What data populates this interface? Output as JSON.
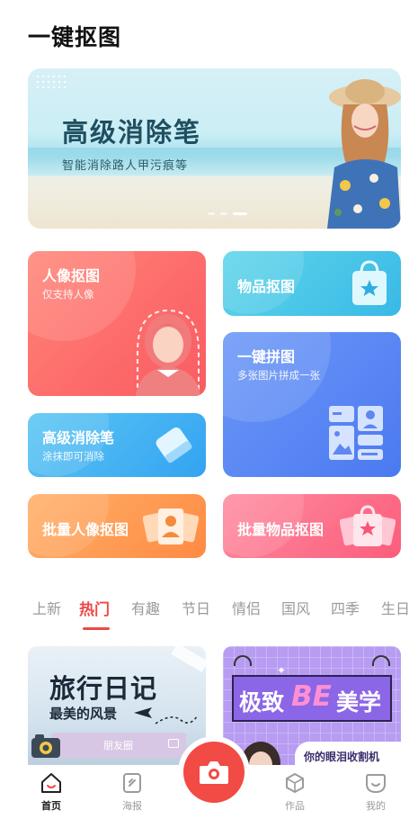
{
  "app": {
    "title": "一键抠图"
  },
  "banner": {
    "title": "高级消除笔",
    "subtitle": "智能消除路人甲污痕等",
    "page_count": 3,
    "active_page": 3
  },
  "features": {
    "portrait": {
      "title": "人像抠图",
      "subtitle": "仅支持人像",
      "icon": "portrait-silhouette-icon"
    },
    "object": {
      "title": "物品抠图",
      "icon": "shopping-bag-icon"
    },
    "collage": {
      "title": "一键拼图",
      "subtitle": "多张图片拼成一张",
      "icon": "collage-grid-icon"
    },
    "eraser": {
      "title": "高级消除笔",
      "subtitle": "涂抹即可消除",
      "icon": "eraser-icon"
    },
    "batch_portrait": {
      "title": "批量人像抠图",
      "icon": "portrait-stack-icon"
    },
    "batch_object": {
      "title": "批量物品抠图",
      "icon": "shopping-bag-stack-icon"
    }
  },
  "categories": {
    "active_index": 1,
    "items": [
      "上新",
      "热门",
      "有趣",
      "节日",
      "情侣",
      "国风",
      "四季",
      "生日"
    ]
  },
  "templates": {
    "travel": {
      "title": "旅行日记",
      "subtitle": "最美的风景",
      "tag": "朋友圈"
    },
    "be": {
      "text_left": "极致",
      "text_mid": "BE",
      "text_right": "美学",
      "ribbon": "你的眼泪收割机"
    }
  },
  "nav": {
    "items": [
      {
        "label": "首页",
        "icon": "home-icon",
        "active": true
      },
      {
        "label": "海报",
        "icon": "poster-icon",
        "active": false
      },
      {
        "label": "作品",
        "icon": "works-box-icon",
        "active": false
      },
      {
        "label": "我的",
        "icon": "profile-face-icon",
        "active": false
      }
    ],
    "center_icon": "camera-icon"
  },
  "colors": {
    "accent": "#ef4848",
    "portrait": "#fd6a6a",
    "object": "#38b9e6",
    "collage": "#4b79f1",
    "eraser": "#33a3f1",
    "batch_portrait": "#ff8a42",
    "batch_object": "#fb5d7b"
  }
}
